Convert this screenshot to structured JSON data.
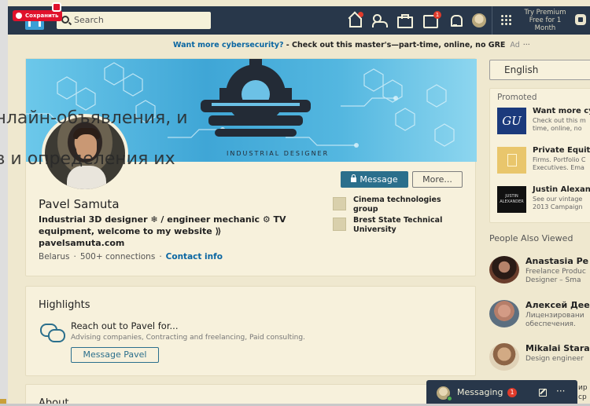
{
  "overlay": {
    "line1": "онлайн-объявления, и",
    "line2": "ов и определения их"
  },
  "pin_button": "Сохранить",
  "search": {
    "placeholder": "Search"
  },
  "nav": {
    "home_badge": "",
    "msgs_badge": "1",
    "premium": [
      "Try Premium",
      "Free for 1",
      "Month"
    ]
  },
  "ad": {
    "link": "Want more cybersecurity?",
    "text": " - Check out this master's—part-time, online, no GRE",
    "tag": "Ad",
    "more": "···"
  },
  "profile": {
    "cover_caption": "INDUSTRIAL DESIGNER",
    "message_button": "Message",
    "more_button": "More...",
    "name": "Pavel Samuta",
    "headline": "Industrial 3D designer ❄ / engineer mechanic ⚙ TV equipment, welcome to my website ⟫ pavelsamuta.com",
    "location": "Belarus",
    "connections": "500+ connections",
    "contact": "Contact info",
    "experience": [
      {
        "name": "Cinema technologies group"
      },
      {
        "name": "Brest State Technical University"
      }
    ]
  },
  "highlights": {
    "title": "Highlights",
    "heading": "Reach out to Pavel for...",
    "sub": "Advising companies, Contracting and freelancing, Paid consulting.",
    "button": "Message Pavel"
  },
  "about": {
    "title": "About"
  },
  "language": {
    "selected": "English"
  },
  "promoted": {
    "label": "Promoted",
    "items": [
      {
        "logo": "GU",
        "title": "Want more cy",
        "desc1": "Check out this m",
        "desc2": "time, online, no"
      },
      {
        "logo": "",
        "title": "Private Equity",
        "desc1": "Firms. Portfolio C",
        "desc2": "Executives. Ema"
      },
      {
        "logo": "JUSTIN ALEXANDER",
        "title": "Justin Alexan",
        "desc1": "See our vintage",
        "desc2": "2013 Campaign"
      }
    ]
  },
  "people_also_viewed": {
    "label": "People Also Viewed",
    "people": [
      {
        "name": "Anastasia Pe",
        "desc1": "Freelance Produc",
        "desc2": "Designer – Sma"
      },
      {
        "name": "Алексей Дее",
        "desc1": "Лицензировани",
        "desc2": "обеспечения."
      },
      {
        "name": "Mikalai Stara",
        "desc1": "Design engineer",
        "desc2": ""
      }
    ]
  },
  "messaging": {
    "label": "Messaging",
    "badge": "1",
    "more": "···"
  },
  "right_peek": [
    "ир",
    "ср"
  ],
  "colors": {
    "nav": "#28374a",
    "accent": "#0a66a2",
    "button": "#2b6f8c",
    "badge": "#e03b2b",
    "pin": "#e0112b"
  }
}
